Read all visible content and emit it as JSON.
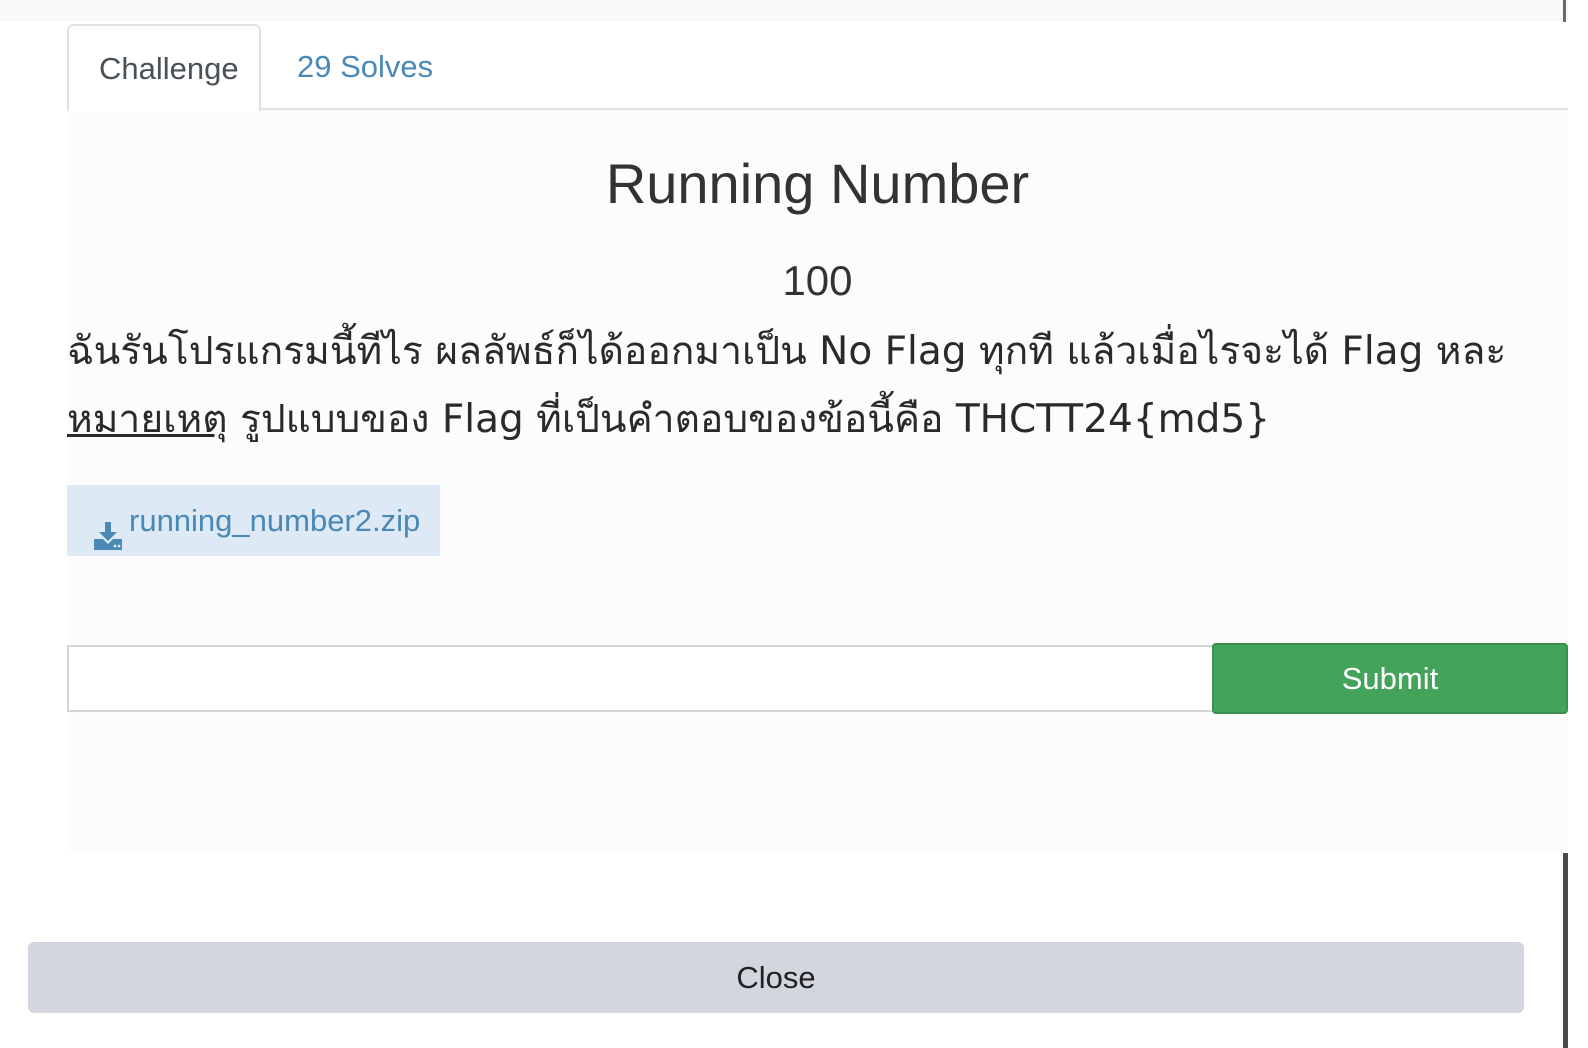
{
  "tabs": {
    "challenge_label": "Challenge",
    "solves_label": "29 Solves"
  },
  "challenge": {
    "name": "Running Number",
    "points": "100",
    "description_line1": "ฉันรันโปรแกรมนี้ทีไร ผลลัพธ์ก็ได้ออกมาเป็น No Flag ทุกที แล้วเมื่อไรจะได้ Flag หละ",
    "note_label": "หมายเหตุ",
    "description_line2": " รูปแบบของ Flag ที่เป็นคำตอบของข้อนี้คือ THCTT24{md5}",
    "file_name": "running_number2.zip",
    "file_icon": "download-icon"
  },
  "submission": {
    "input_value": "",
    "input_placeholder": "",
    "submit_label": "Submit"
  },
  "footer": {
    "close_label": "Close"
  },
  "colors": {
    "tab_link": "#4a88b5",
    "file_bg": "#ddeaf6",
    "submit_bg": "#44a35a",
    "close_bg": "#d3d6de"
  }
}
